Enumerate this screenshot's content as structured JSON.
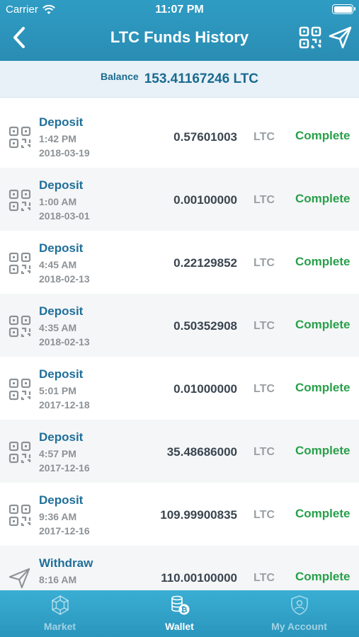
{
  "status_bar": {
    "carrier": "Carrier",
    "time": "11:07 PM"
  },
  "header": {
    "title": "LTC Funds History"
  },
  "balance": {
    "label": "Balance",
    "value": "153.41167246 LTC"
  },
  "colors": {
    "header": "#2a8db3",
    "link": "#1f6f9a",
    "complete": "#27a04a",
    "tabbar": "#3aaed3"
  },
  "transactions": [
    {
      "type": "Deposit",
      "time": "1:42 PM",
      "date": "2018-03-19",
      "amount": "0.57601003",
      "currency": "LTC",
      "status": "Complete",
      "icon": "qr-code-icon"
    },
    {
      "type": "Deposit",
      "time": "1:00 AM",
      "date": "2018-03-01",
      "amount": "0.00100000",
      "currency": "LTC",
      "status": "Complete",
      "icon": "qr-code-icon"
    },
    {
      "type": "Deposit",
      "time": "4:45 AM",
      "date": "2018-02-13",
      "amount": "0.22129852",
      "currency": "LTC",
      "status": "Complete",
      "icon": "qr-code-icon"
    },
    {
      "type": "Deposit",
      "time": "4:35 AM",
      "date": "2018-02-13",
      "amount": "0.50352908",
      "currency": "LTC",
      "status": "Complete",
      "icon": "qr-code-icon"
    },
    {
      "type": "Deposit",
      "time": "5:01 PM",
      "date": "2017-12-18",
      "amount": "0.01000000",
      "currency": "LTC",
      "status": "Complete",
      "icon": "qr-code-icon"
    },
    {
      "type": "Deposit",
      "time": "4:57 PM",
      "date": "2017-12-16",
      "amount": "35.48686000",
      "currency": "LTC",
      "status": "Complete",
      "icon": "qr-code-icon"
    },
    {
      "type": "Deposit",
      "time": "9:36 AM",
      "date": "2017-12-16",
      "amount": "109.99900835",
      "currency": "LTC",
      "status": "Complete",
      "icon": "qr-code-icon"
    },
    {
      "type": "Withdraw",
      "time": "8:16 AM",
      "date": "",
      "amount": "110.00100000",
      "currency": "LTC",
      "status": "Complete",
      "icon": "send-icon"
    }
  ],
  "tabs": [
    {
      "label": "Market",
      "icon": "market-icon",
      "active": false
    },
    {
      "label": "Wallet",
      "icon": "wallet-icon",
      "active": true
    },
    {
      "label": "My Account",
      "icon": "account-icon",
      "active": false
    }
  ]
}
